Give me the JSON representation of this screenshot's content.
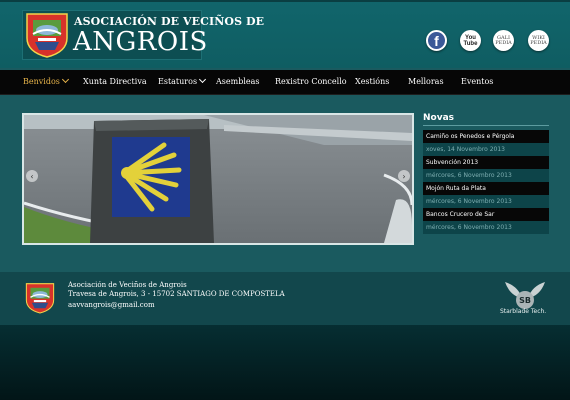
{
  "header": {
    "logo_sub": "ASOCIACIÓN DE VECIÑOS DE",
    "logo_main": "ANGROIS",
    "social": {
      "facebook": "f",
      "youtube": "You Tube",
      "galipedia_1": "GALI",
      "galipedia_2": "PEDIA",
      "wikipedia_1": "WIKI",
      "wikipedia_2": "PEDIA"
    }
  },
  "nav": {
    "items": [
      {
        "label": "Benvidos"
      },
      {
        "label": "Xunta Directiva"
      },
      {
        "label": "Estaturos"
      },
      {
        "label": "Asembleas"
      },
      {
        "label": "Rexistro Concello"
      },
      {
        "label": "Xestións"
      },
      {
        "label": "Melloras"
      },
      {
        "label": "Eventos"
      }
    ]
  },
  "news": {
    "title": "Novas",
    "items": [
      {
        "title": "Camiño os Penedos e Pérgola",
        "date": "xoves, 14 Novembro 2013"
      },
      {
        "title": "Subvención 2013",
        "date": "mércores, 6 Novembro 2013"
      },
      {
        "title": "Mojón Ruta da Plata",
        "date": "mércores, 6 Novembro 2013"
      },
      {
        "title": "Bancos Crucero de Sar",
        "date": "mércores, 6 Novembro 2013"
      }
    ]
  },
  "footer": {
    "org": "Asociación de Veciños de Angrois",
    "address": "Travesa de Angrois, 3 - 15702 SANTIAGO DE COMPOSTELA",
    "email": "aavvangrois@gmail.com",
    "sb_mark": "SB",
    "credit": "Starblade Tech."
  },
  "colors": {
    "accent_nav_active": "#e6b34a",
    "header_bg": "#11656b",
    "nav_bg": "#060606",
    "body_bg": "#1a5a5f"
  },
  "icons": [
    "facebook-icon",
    "youtube-icon",
    "galipedia-icon",
    "wikipedia-icon",
    "slider-prev-icon",
    "slider-next-icon",
    "chevron-down-icon"
  ]
}
